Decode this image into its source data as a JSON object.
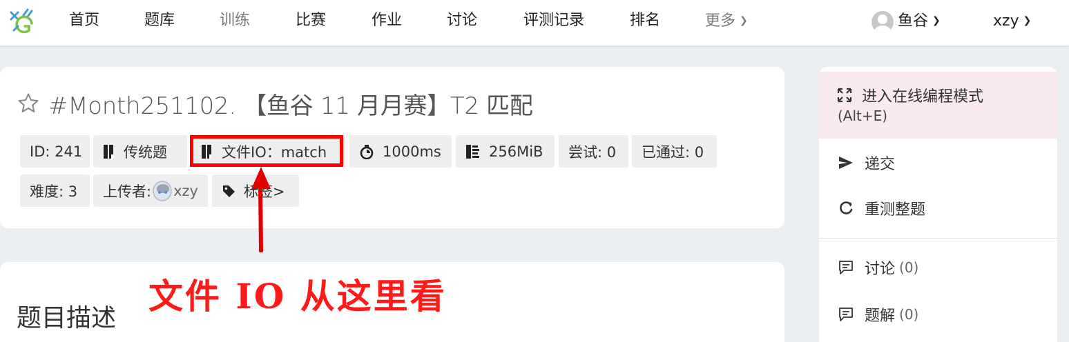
{
  "nav": {
    "items": [
      {
        "label": "首页"
      },
      {
        "label": "题库"
      },
      {
        "label": "训练"
      },
      {
        "label": "比赛"
      },
      {
        "label": "作业"
      },
      {
        "label": "讨论"
      },
      {
        "label": "评测记录"
      },
      {
        "label": "排名"
      },
      {
        "label": "更多"
      }
    ],
    "domain_label": "鱼谷",
    "username": "xzy"
  },
  "problem": {
    "title": "#Month251102. 【鱼谷 11 月月赛】T2 匹配",
    "tags": {
      "id": "ID: 241",
      "type": "传统题",
      "fileio": "文件IO：match",
      "time_limit": "1000ms",
      "memory_limit": "256MiB",
      "tried": "尝试: 0",
      "accepted": "已通过: 0",
      "difficulty": "难度: 3",
      "uploader_prefix": "上传者:",
      "uploader": "xzy",
      "labels": "标签>"
    },
    "annotation": "文件 IO 从这里看",
    "section_title": "题目描述"
  },
  "sidebar": {
    "online_mode_line1": "进入在线编程模式",
    "online_mode_line2": "(Alt+E)",
    "submit": "递交",
    "rejudge": "重测整题",
    "discussion": "讨论",
    "discussion_count": "(0)",
    "solution": "题解",
    "solution_count": "(0)"
  },
  "colors": {
    "highlight": "#ff0000",
    "annotation": "#ff1a1a",
    "sidebar_active_bg": "#fbeaed",
    "logo_blue": "#3b9ddb",
    "logo_green": "#7cc243"
  }
}
